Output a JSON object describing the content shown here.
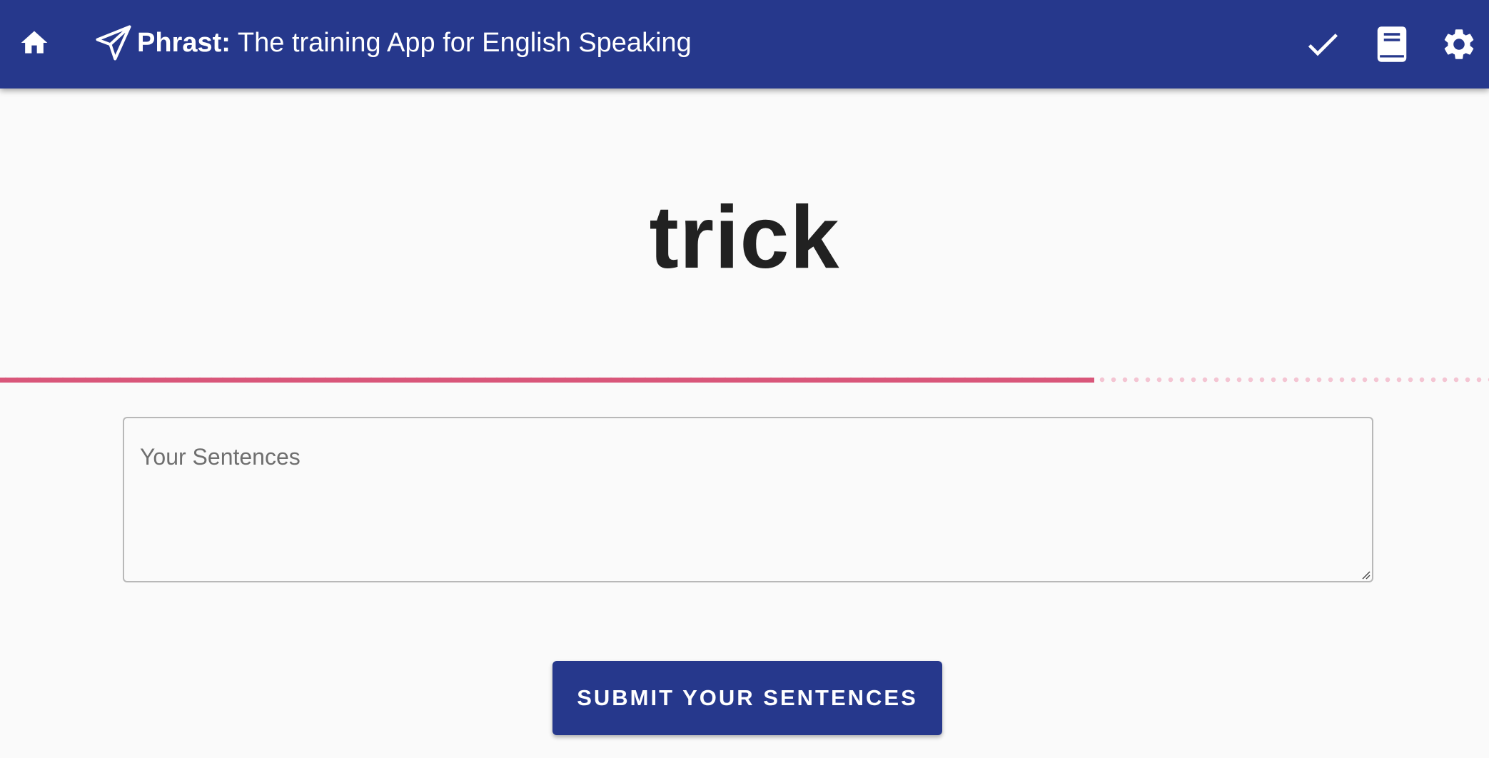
{
  "app": {
    "name": "Phrast:",
    "tagline": "The training App for English Speaking"
  },
  "header": {
    "icons": [
      "home-icon",
      "paper-plane-icon",
      "check-icon",
      "book-icon",
      "gear-icon"
    ]
  },
  "word": "trick",
  "progress": {
    "fraction": 0.735
  },
  "sentences": {
    "placeholder": "Your Sentences",
    "value": ""
  },
  "submit": {
    "label": "SUBMIT YOUR SENTENCES"
  },
  "colors": {
    "appbar": "#26388c",
    "accent": "#d9567a",
    "accent_light": "#f4c5d3",
    "background": "#fafafa",
    "text": "#212121"
  }
}
